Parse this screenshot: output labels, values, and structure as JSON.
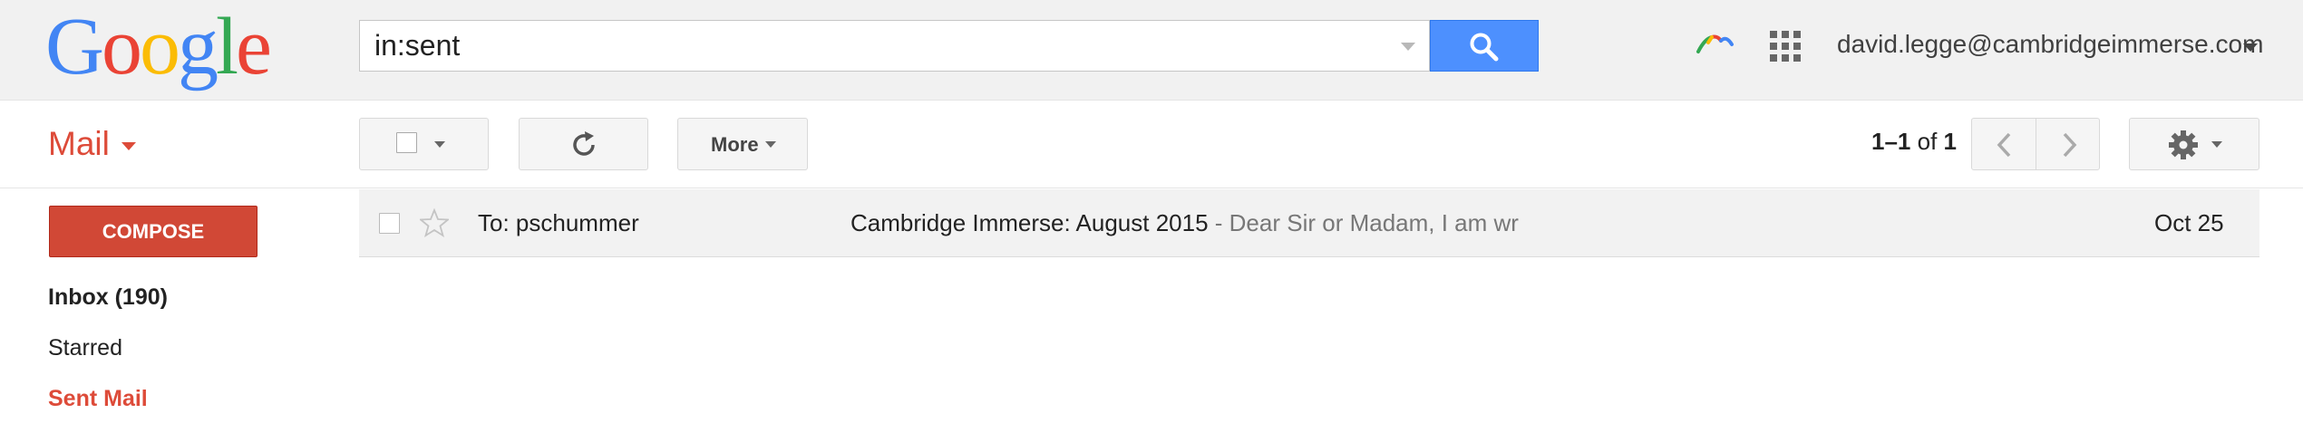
{
  "header": {
    "logo_text": "Google",
    "search_value": "in:sent",
    "account_email": "david.legge@cambridgeimmerse.com"
  },
  "toolbar": {
    "mail_label": "Mail",
    "more_label": "More",
    "pagination": {
      "range": "1–1",
      "of_label": "of",
      "total": "1"
    }
  },
  "sidebar": {
    "compose_label": "COMPOSE",
    "items": [
      {
        "label": "Inbox (190)"
      },
      {
        "label": "Starred"
      },
      {
        "label": "Sent Mail"
      }
    ]
  },
  "messages": [
    {
      "recipient": "To: pschummer",
      "subject": "Cambridge Immerse: August 2015",
      "separator": " - ",
      "snippet": "Dear Sir or Madam, I am writing to inform your student body at your school about C",
      "date": "Oct 25"
    }
  ],
  "colors": {
    "brand_red": "#dd4b39",
    "compose_red": "#d14836",
    "search_blue": "#4d90fe",
    "header_bg": "#f1f1f1"
  },
  "icons": [
    "google-logo",
    "search-icon",
    "google-plus-logo-icon",
    "apps-grid-icon",
    "refresh-icon",
    "chevron-left-icon",
    "chevron-right-icon",
    "gear-icon",
    "star-icon"
  ]
}
